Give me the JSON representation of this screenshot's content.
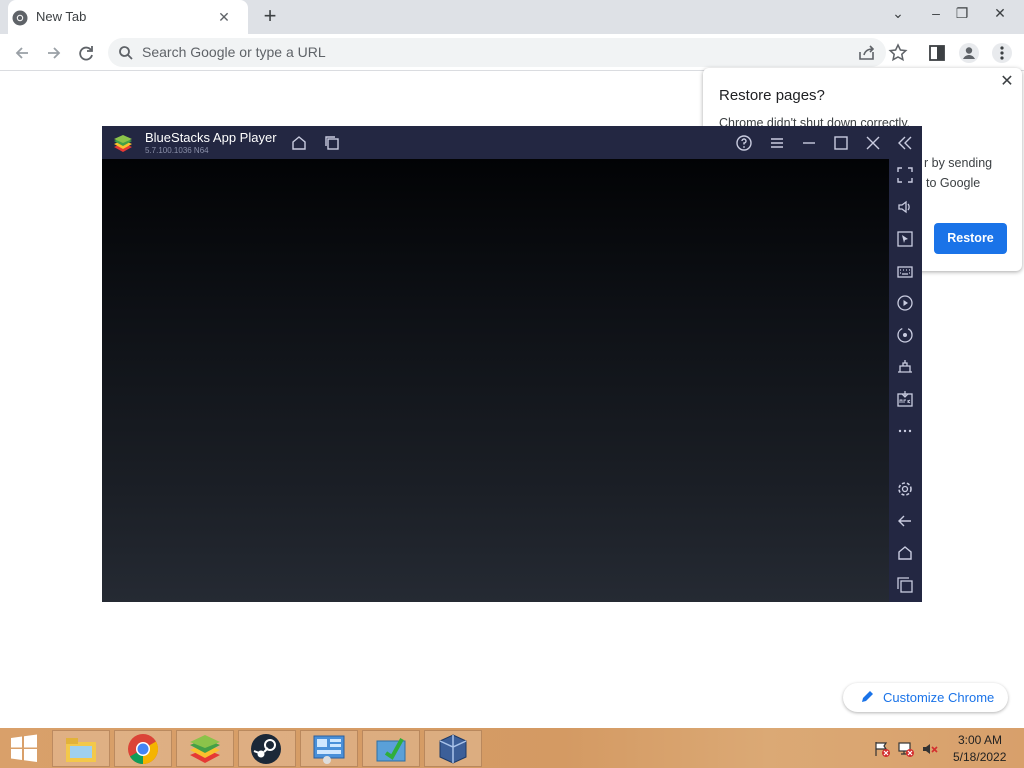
{
  "browser": {
    "tab": {
      "title": "New Tab",
      "close": "✕",
      "favicon": "chrome-favicon-icon"
    },
    "new_tab": "+",
    "window_controls": {
      "minimize": "–",
      "restore": "❐",
      "close": "✕",
      "tab_search": "⌄"
    },
    "omnibox": {
      "placeholder": "Search Google or type a URL"
    },
    "icons": [
      "back-icon",
      "forward-icon",
      "reload-icon",
      "search-icon",
      "share-icon",
      "star-icon",
      "side-panel-icon",
      "profile-icon",
      "menu-icon"
    ]
  },
  "restore_popup": {
    "title": "Restore pages?",
    "body_line1": "Chrome didn't shut down correctly.",
    "body_line2": "r by sending",
    "body_line3": "to Google",
    "close": "✕",
    "button": "Restore"
  },
  "bluestacks": {
    "title": "BlueStacks App Player",
    "version": "5.7.100.1036  N64",
    "title_icons": [
      "home-icon",
      "multi-instance-icon",
      "help-icon",
      "menu-icon",
      "minimize-icon",
      "maximize-icon",
      "close-icon",
      "collapse-sidebar-icon"
    ],
    "sidebar_icons": [
      "fullscreen-icon",
      "volume-icon",
      "pointer-icon",
      "keyboard-icon",
      "macro-icon",
      "rotate-icon",
      "screenshot-icon",
      "apk-icon",
      "more-icon",
      "settings-icon",
      "back-icon",
      "home-icon",
      "recent-apps-icon"
    ]
  },
  "customize_chrome": {
    "label": "Customize Chrome"
  },
  "taskbar": {
    "apps": [
      "windows-start-icon",
      "file-explorer-icon",
      "chrome-icon",
      "bluestacks-icon",
      "steam-icon",
      "control-panel-icon",
      "action-center-icon",
      "virtualbox-icon"
    ],
    "tray": [
      "flag-icon",
      "network-icon",
      "volume-muted-icon"
    ],
    "clock_time": "3:00 AM",
    "clock_date": "5/18/2022"
  },
  "colors": {
    "accent": "#1a73e8",
    "bluestacks_bar": "#232742",
    "taskbar": "#d9a06a"
  }
}
